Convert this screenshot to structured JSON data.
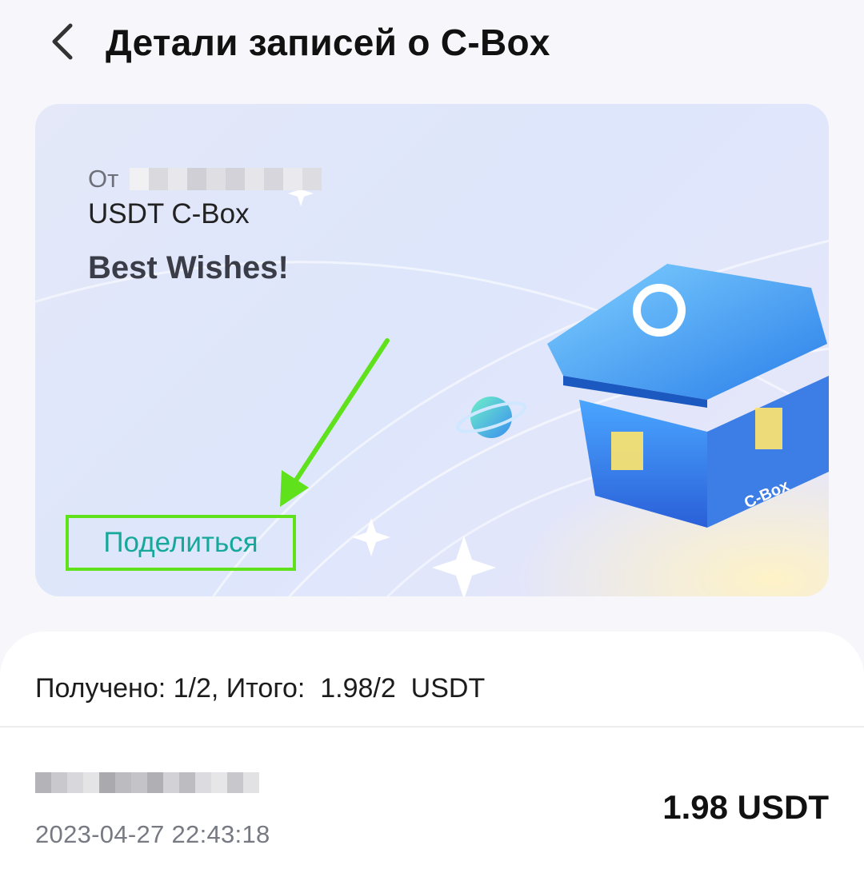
{
  "header": {
    "title": "Детали записей о C-Box",
    "back_icon": "chevron-left-icon"
  },
  "card": {
    "from_label": "От",
    "box_name": "USDT C-Box",
    "message": "Best Wishes!",
    "share_label": "Поделиться",
    "box_badge": "C-Box",
    "colors": {
      "share_text": "#16a89a",
      "highlight": "#5fe21c",
      "box_blue": "#2f8ff0"
    }
  },
  "summary": {
    "text": "Получено: 1/2, Итого:  1.98/2  USDT"
  },
  "records": [
    {
      "time": "2023-04-27 22:43:18",
      "amount": "1.98 USDT"
    }
  ]
}
